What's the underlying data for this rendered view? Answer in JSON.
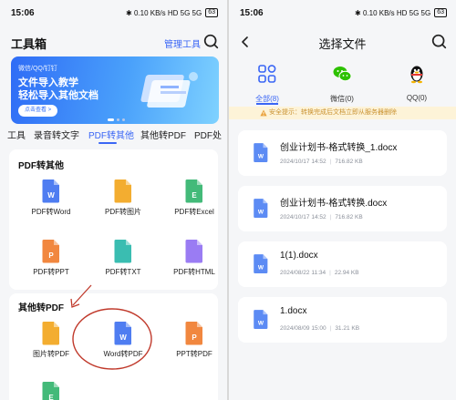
{
  "status": {
    "time": "15:06",
    "icons": "✱ 0.10 KB/s HD 5G 5G",
    "battery": "63"
  },
  "left": {
    "title": "工具箱",
    "manage": "管理工具",
    "banner": {
      "small": "微信/QQ/钉钉",
      "line1": "文件导入教学",
      "line2": "轻松导入其他文档",
      "button": "点击查看 >"
    },
    "tabs": [
      "工具",
      "录音转文字",
      "PDF转其他",
      "其他转PDF",
      "PDF处"
    ],
    "section1": {
      "title": "PDF转其他",
      "tools": [
        {
          "label": "PDF转Word",
          "badge": "W",
          "color": "#3c6ff0"
        },
        {
          "label": "PDF转图片",
          "badge": "",
          "color": "#f2a41a"
        },
        {
          "label": "PDF转Excel",
          "badge": "E",
          "color": "#2fb36a"
        },
        {
          "label": "PDF转PPT",
          "badge": "P",
          "color": "#f07a2a"
        },
        {
          "label": "PDF转TXT",
          "badge": "",
          "color": "#25b6a8"
        },
        {
          "label": "PDF转HTML",
          "badge": "</>",
          "color": "#8f6ef2"
        }
      ]
    },
    "section2": {
      "title": "其他转PDF",
      "tools": [
        {
          "label": "图片转PDF",
          "badge": "",
          "color": "#f2a41a"
        },
        {
          "label": "Word转PDF",
          "badge": "W",
          "color": "#3c6ff0"
        },
        {
          "label": "PPT转PDF",
          "badge": "P",
          "color": "#f07a2a"
        },
        {
          "label": "",
          "badge": "E",
          "color": "#2fb36a"
        }
      ]
    }
  },
  "right": {
    "title": "选择文件",
    "categories": [
      {
        "label": "全部(8)"
      },
      {
        "label": "微信(0)"
      },
      {
        "label": "QQ(0)"
      }
    ],
    "notice": "安全提示：转换完成后文档立即从服务器删除",
    "files": [
      {
        "name": "创业计划书-格式转换_1.docx",
        "date": "2024/10/17 14:52",
        "size": "716.82 KB"
      },
      {
        "name": "创业计划书-格式转换.docx",
        "date": "2024/10/17 14:52",
        "size": "716.82 KB"
      },
      {
        "name": "1(1).docx",
        "date": "2024/08/22 11:34",
        "size": "22.94 KB"
      },
      {
        "name": "1.docx",
        "date": "2024/08/09 15:00",
        "size": "31.21 KB"
      }
    ]
  },
  "colors": {
    "accent": "#3a66f5",
    "annotation": "#c0392b"
  }
}
